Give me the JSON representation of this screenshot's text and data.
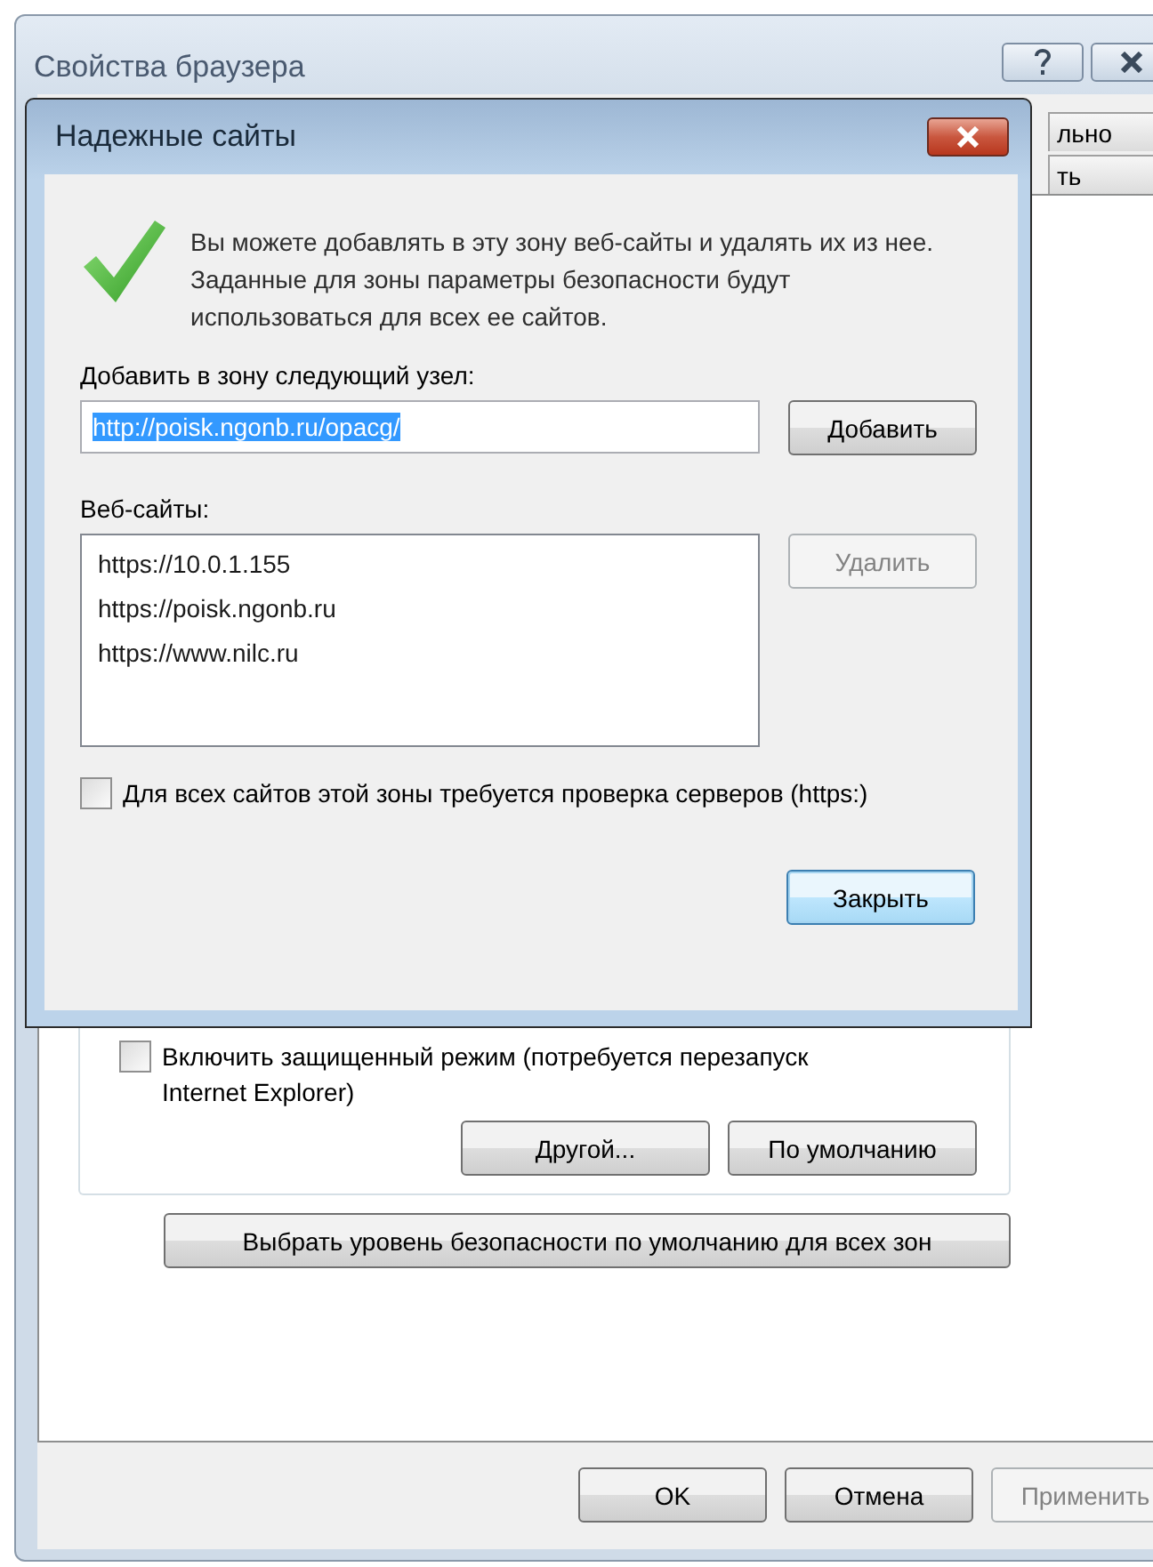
{
  "window": {
    "title": "Свойства браузера"
  },
  "tabs": [
    {
      "label": "льно"
    },
    {
      "label": "ть"
    }
  ],
  "security_panel": {
    "protected_mode": {
      "label": "Включить защищенный режим (потребуется перезапуск Internet Explorer)",
      "checked": false
    },
    "buttons": [
      "Другой...",
      "По умолчанию"
    ],
    "reset_all_button": "Выбрать уровень безопасности по умолчанию для всех зон"
  },
  "footer_buttons": [
    {
      "label": "OK",
      "disabled": false
    },
    {
      "label": "Отмена",
      "disabled": false
    },
    {
      "label": "Применить",
      "disabled": true
    }
  ],
  "dialog": {
    "title": "Надежные сайты",
    "description": "Вы можете добавлять в эту зону  веб-сайты и удалять их из нее. Заданные для зоны параметры безопасности будут использоваться для всех ее сайтов.",
    "add_label": "Добавить в зону следующий узел:",
    "add_field": {
      "value": "http://poisk.ngonb.ru/opacg/"
    },
    "add_button": "Добавить",
    "websites_label": "Веб-сайты:",
    "websites": [
      "https://10.0.1.155",
      "https://poisk.ngonb.ru",
      "https://www.nilc.ru"
    ],
    "remove_button": {
      "label": "Удалить",
      "disabled": true
    },
    "require_https": {
      "label": "Для всех сайтов этой зоны требуется проверка серверов (https:)",
      "checked": false
    },
    "close_button": "Закрыть"
  }
}
